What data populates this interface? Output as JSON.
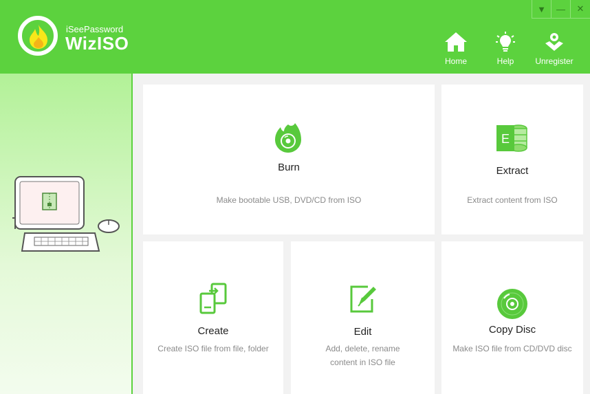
{
  "app": {
    "vendor": "iSeePassword",
    "name": "WizISO"
  },
  "window_controls": {
    "dropdown": "▼",
    "minimize": "—",
    "close": "✕"
  },
  "nav": {
    "home": "Home",
    "help": "Help",
    "unregister": "Unregister"
  },
  "cards": {
    "burn": {
      "title": "Burn",
      "desc": "Make bootable USB, DVD/CD from ISO",
      "icon": "burn-disc-icon"
    },
    "extract": {
      "title": "Extract",
      "desc": "Extract content from ISO",
      "icon": "extract-e-icon",
      "glyph": "E"
    },
    "create": {
      "title": "Create",
      "desc": "Create ISO file from file, folder",
      "icon": "create-files-icon"
    },
    "edit": {
      "title": "Edit",
      "desc_line1": "Add, delete, rename",
      "desc_line2": "content in ISO file",
      "icon": "edit-pencil-icon"
    },
    "copy": {
      "title": "Copy Disc",
      "desc": "Make ISO file from CD/DVD disc",
      "icon": "disc-icon"
    }
  },
  "colors": {
    "accent": "#5cd23e",
    "card_bg": "#ffffff",
    "content_bg": "#f2f2f2"
  }
}
